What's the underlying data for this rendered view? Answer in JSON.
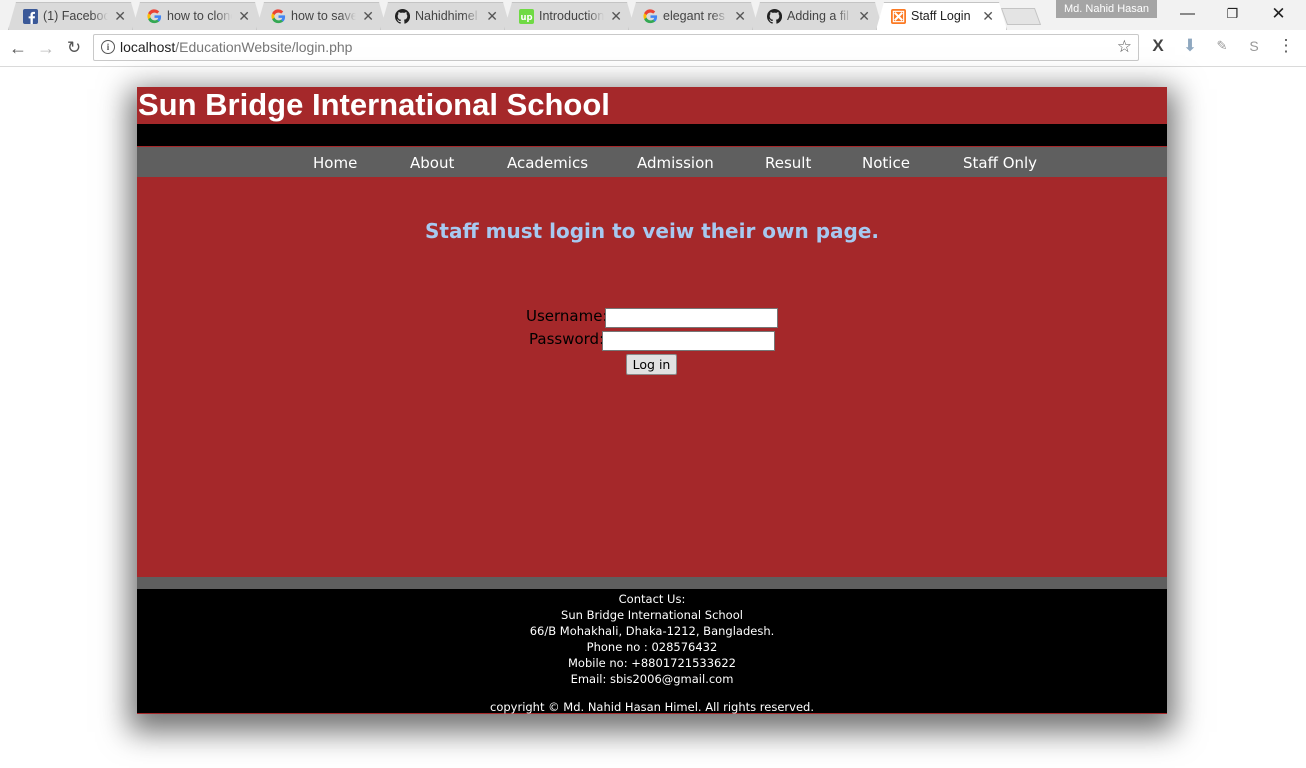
{
  "browser": {
    "tabs": [
      {
        "title": "(1) Facebook",
        "icon": "facebook-icon"
      },
      {
        "title": "how to clone",
        "icon": "google-icon"
      },
      {
        "title": "how to save",
        "icon": "google-icon"
      },
      {
        "title": "Nahidhimel",
        "icon": "github-icon"
      },
      {
        "title": "Introduction",
        "icon": "upwork-icon"
      },
      {
        "title": "elegant res",
        "icon": "google-icon"
      },
      {
        "title": "Adding a fil",
        "icon": "github-icon"
      },
      {
        "title": "Staff Login",
        "icon": "xampp-icon",
        "active": true
      }
    ],
    "profile_name": "Md. Nahid Hasan",
    "url_host": "localhost",
    "url_path": "/EducationWebsite/login.php"
  },
  "site": {
    "title": "Sun Bridge International School",
    "nav": [
      "Home",
      "About",
      "Academics",
      "Admission",
      "Result",
      "Notice",
      "Staff Only"
    ],
    "notice": "Staff must login to veiw their own page.",
    "form": {
      "username_label": "Username:",
      "password_label": "Password:",
      "username_value": "",
      "password_value": "",
      "login_button": "Log in"
    },
    "footer": {
      "heading": "Contact Us:",
      "school": "Sun Bridge International School",
      "address": "66/B Mohakhali, Dhaka-1212, Bangladesh.",
      "phone": "Phone no : 028576432",
      "mobile": "Mobile no: +8801721533622",
      "email": "Email: sbis2006@gmail.com",
      "copyright": "copyright © Md. Nahid Hasan Himel. All rights reserved."
    }
  },
  "colors": {
    "brand_red": "#a5282a",
    "menu_gray": "#5f5f5f",
    "notice_blue": "#a7c9f0"
  }
}
